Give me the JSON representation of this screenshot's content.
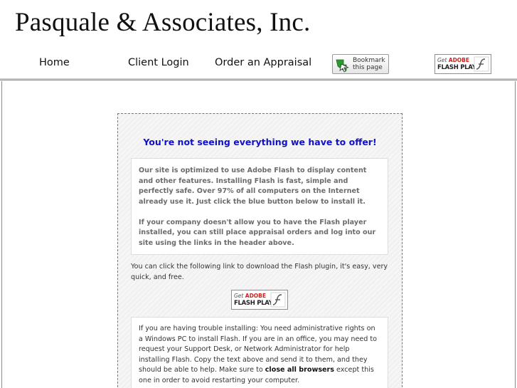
{
  "header": {
    "site_title": "Pasquale & Associates, Inc.",
    "nav": {
      "home": "Home",
      "client_login": "Client Login",
      "order_appraisal": "Order an Appraisal"
    },
    "bookmark": {
      "line1": "Bookmark",
      "line2": "this page",
      "icon": "bookmark-arrow-icon"
    },
    "flash_badge": {
      "get": "Get",
      "adobe": "ADOBE",
      "flash_player": "FLASH PLAYER",
      "icon": "flash-logo-icon"
    }
  },
  "panel": {
    "heading": "You're not seeing everything we have to offer!",
    "info": {
      "paragraph1": "Our site is optimized to use Adobe Flash to display content and other features. Installing Flash is fast, simple and perfectly safe. Over 97% of all computers on the Internet already use it. Just click the blue button below to install it.",
      "paragraph2": "If your company doesn't allow you to have the Flash player installed, you can still place appraisal orders and log into our site using the links in the header above."
    },
    "download_text": "You can click the following link to download the Flash plugin, it's easy, very quick, and free.",
    "trouble": {
      "text_before": "If you are having trouble installing: You need administrative rights on a Windows PC to install Flash. If you are in an office, you may need to request your Support Desk, or Network Administrator for help installing Flash. Copy the text above and send it to them, and they should be able to help. Make sure to ",
      "bold": "close all browsers",
      "text_after": " except this one in order to avoid restarting your computer."
    }
  },
  "colors": {
    "heading_blue": "#1010cc",
    "adobe_red": "#cc2222",
    "bookmark_green": "#2e9a2e"
  }
}
